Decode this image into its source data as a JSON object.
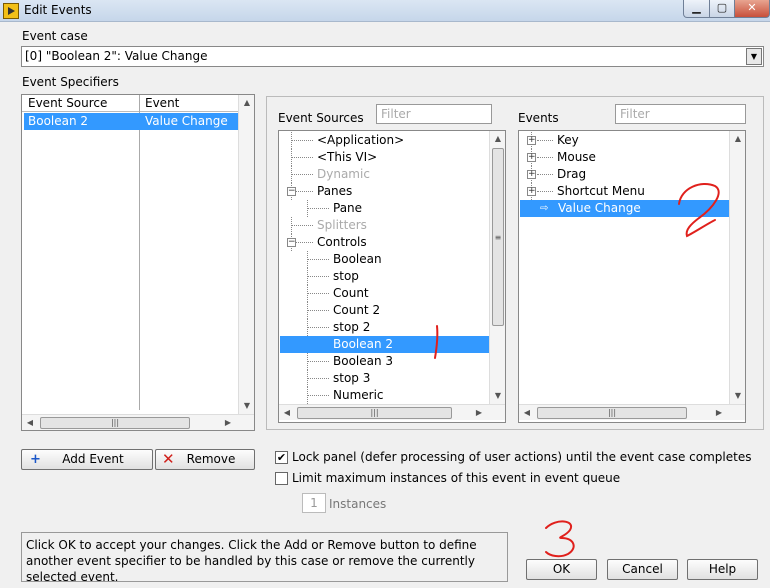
{
  "window": {
    "title": "Edit Events"
  },
  "event_case": {
    "label": "Event case",
    "value": "[0] \"Boolean 2\": Value Change"
  },
  "event_specifiers": {
    "label": "Event Specifiers",
    "columns": [
      "Event Source",
      "Event"
    ],
    "rows": [
      {
        "source": "Boolean 2",
        "event": "Value Change"
      }
    ]
  },
  "event_sources": {
    "label": "Event Sources",
    "filter_placeholder": "Filter",
    "items": [
      {
        "label": "<Application>",
        "dim": false,
        "level": 0
      },
      {
        "label": "<This VI>",
        "dim": false,
        "level": 0
      },
      {
        "label": "Dynamic",
        "dim": true,
        "level": 0
      },
      {
        "label": "Panes",
        "dim": false,
        "level": 0,
        "expander": "minus"
      },
      {
        "label": "Pane",
        "dim": false,
        "level": 1
      },
      {
        "label": "Splitters",
        "dim": true,
        "level": 0
      },
      {
        "label": "Controls",
        "dim": false,
        "level": 0,
        "expander": "minus"
      },
      {
        "label": "Boolean",
        "dim": false,
        "level": 1
      },
      {
        "label": "stop",
        "dim": false,
        "level": 1
      },
      {
        "label": "Count",
        "dim": false,
        "level": 1
      },
      {
        "label": "Count 2",
        "dim": false,
        "level": 1
      },
      {
        "label": "stop 2",
        "dim": false,
        "level": 1
      },
      {
        "label": "Boolean 2",
        "dim": false,
        "level": 1,
        "selected": true
      },
      {
        "label": "Boolean 3",
        "dim": false,
        "level": 1
      },
      {
        "label": "stop 3",
        "dim": false,
        "level": 1
      },
      {
        "label": "Numeric",
        "dim": false,
        "level": 1
      }
    ]
  },
  "events": {
    "label": "Events",
    "filter_placeholder": "Filter",
    "items": [
      {
        "label": "Key",
        "expander": "plus"
      },
      {
        "label": "Mouse",
        "expander": "plus"
      },
      {
        "label": "Drag",
        "expander": "plus"
      },
      {
        "label": "Shortcut Menu",
        "expander": "plus"
      },
      {
        "label": "Value Change",
        "selected": true,
        "arrow": "⇨"
      }
    ]
  },
  "buttons": {
    "add_event": "Add Event",
    "remove": "Remove",
    "ok": "OK",
    "cancel": "Cancel",
    "help": "Help"
  },
  "options": {
    "lock_panel": {
      "label": "Lock panel (defer processing of user actions) until the event case completes",
      "checked": true
    },
    "limit_instances": {
      "label": "Limit maximum instances of this event in event queue",
      "checked": false
    },
    "instances_value": "1",
    "instances_label": "Instances"
  },
  "help_text": "Click OK to accept your changes.  Click the Add or Remove button to define another event specifier to be handled by this case or remove the currently selected event.",
  "annotations": [
    "1",
    "2",
    "3"
  ],
  "colors": {
    "selection": "#3399ff",
    "annotation": "#e0201c",
    "dim_text": "#aaaaaa"
  }
}
